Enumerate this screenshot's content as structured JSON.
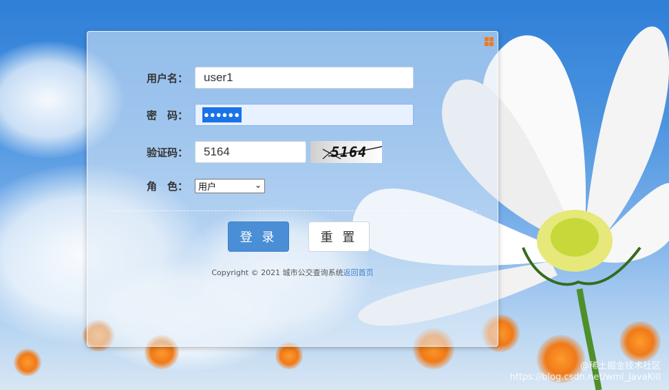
{
  "form": {
    "username_label": "用户名：",
    "username_value": "user1",
    "password_label": "密　码：",
    "password_mask": "●●●●●●",
    "captcha_label": "验证码：",
    "captcha_value": "5164",
    "captcha_image_text": "5164",
    "role_label": "角　色：",
    "role_selected": "用户"
  },
  "buttons": {
    "login": "登 录",
    "reset": "重 置"
  },
  "footer": {
    "copyright": "Copyright © 2021 城市公交查询系统",
    "home_link": "返回首页"
  },
  "watermark": {
    "line1": "@稀土掘金技术社区",
    "line2": "https://blog.csdn.net/wml_JavaKill"
  },
  "colors": {
    "primary": "#4a8ed6",
    "accent_icon": "#ef7a22"
  },
  "icons": {
    "corner": "grid-icon",
    "select": "chevron-down-icon"
  }
}
